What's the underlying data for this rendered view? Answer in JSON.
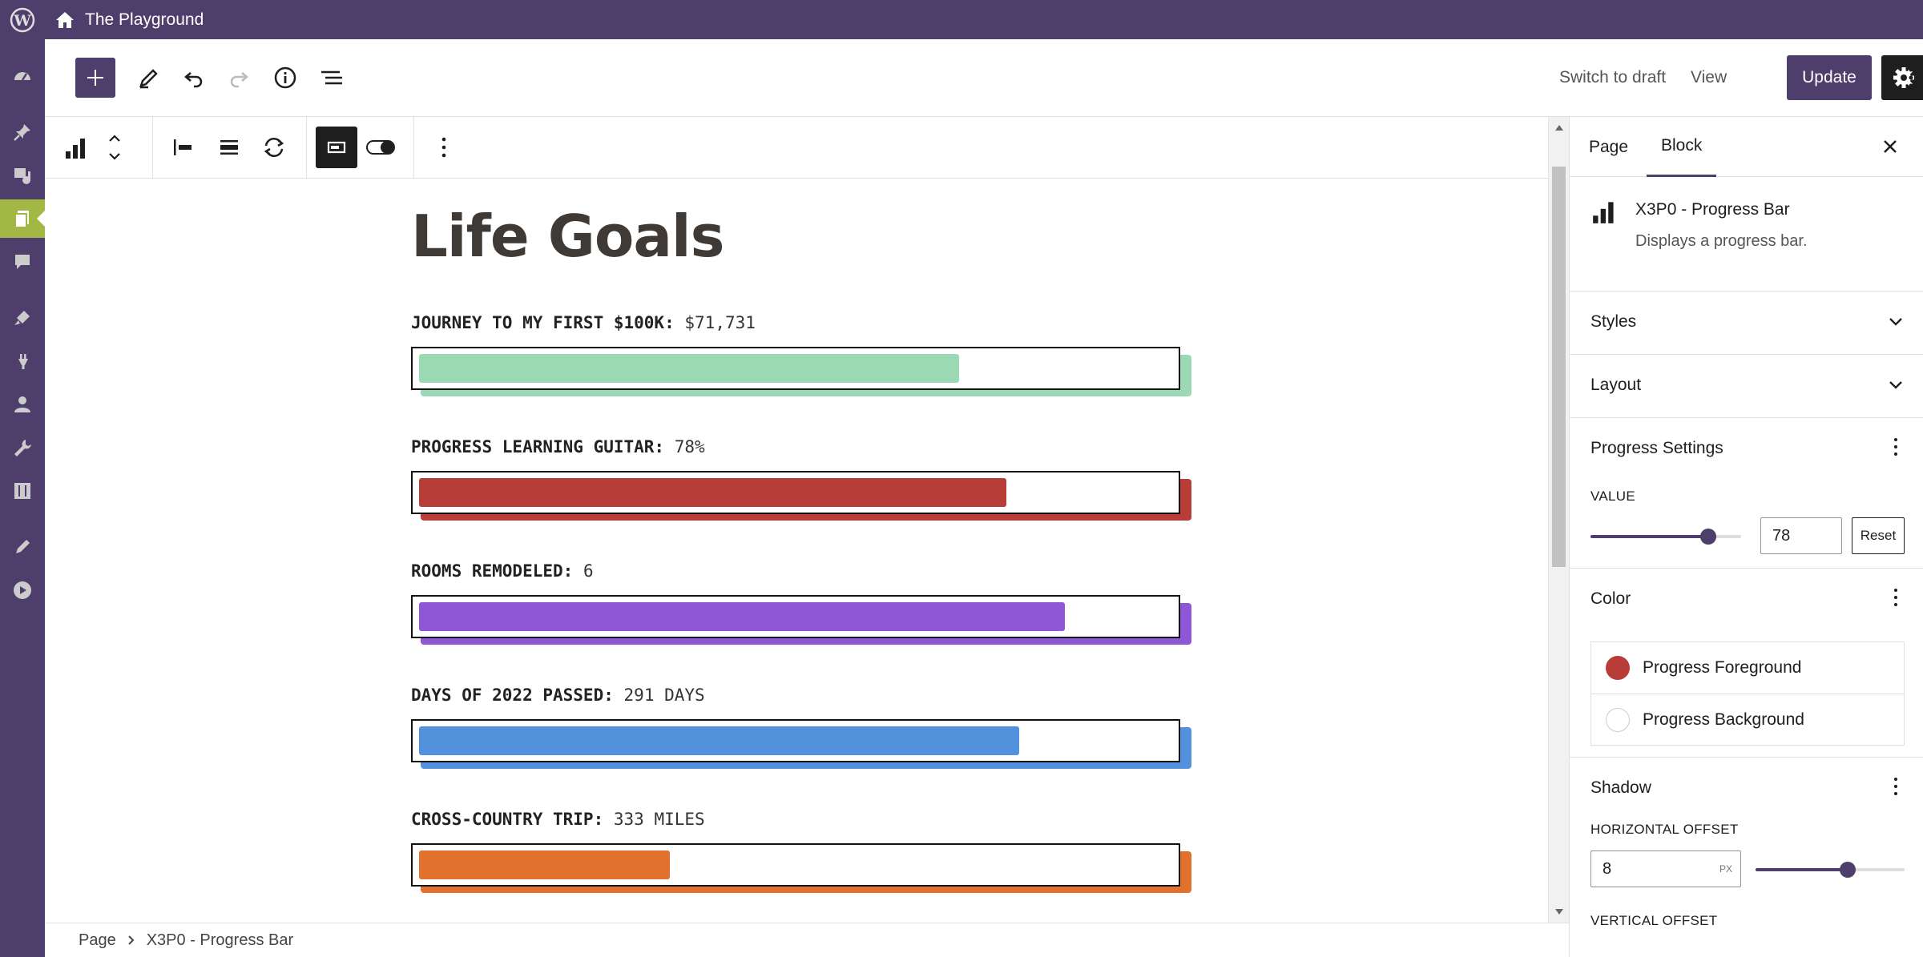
{
  "admin_bar": {
    "site_title": "The Playground"
  },
  "header": {
    "switch_to_draft": "Switch to draft",
    "view": "View",
    "update": "Update"
  },
  "page": {
    "title": "Life Goals",
    "goals": [
      {
        "label": "JOURNEY TO MY FIRST $100K:",
        "value": "$71,731",
        "progress": 0.7173,
        "color": "#9bd9b5"
      },
      {
        "label": "PROGRESS LEARNING GUITAR:",
        "value": "78%",
        "progress": 0.78,
        "color": "#b83c37"
      },
      {
        "label": "ROOMS REMODELED:",
        "value": "6",
        "progress": 0.857,
        "color": "#8f57d8"
      },
      {
        "label": "DAYS OF 2022 PASSED:",
        "value": "291 DAYS",
        "progress": 0.797,
        "color": "#5291db"
      },
      {
        "label": "CROSS-COUNTRY TRIP:",
        "value": "333 MILES",
        "progress": 0.333,
        "color": "#e3712e"
      }
    ]
  },
  "breadcrumb": {
    "root": "Page",
    "current": "X3P0 - Progress Bar"
  },
  "sidebar": {
    "tabs": {
      "page": "Page",
      "block": "Block"
    },
    "block_card": {
      "title": "X3P0 - Progress Bar",
      "description": "Displays a progress bar."
    },
    "styles": "Styles",
    "layout": "Layout",
    "progress_settings": {
      "title": "Progress Settings",
      "value_label": "VALUE",
      "value": "78",
      "slider_level": 0.78,
      "reset": "Reset"
    },
    "color": {
      "title": "Color",
      "foreground": {
        "label": "Progress Foreground",
        "swatch": "#b83c37"
      },
      "background": {
        "label": "Progress Background",
        "swatch": "#ffffff"
      }
    },
    "shadow": {
      "title": "Shadow",
      "horizontal_label": "HORIZONTAL OFFSET",
      "horizontal_value": "8",
      "horizontal_unit": "PX",
      "horizontal_level": 0.62,
      "vertical_label": "VERTICAL OFFSET"
    }
  }
}
